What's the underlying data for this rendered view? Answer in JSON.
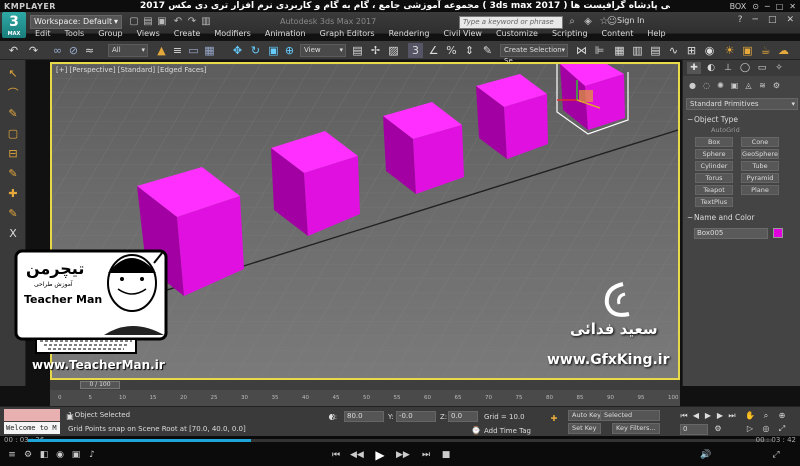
{
  "player": {
    "logo": "KMPLAYER",
    "title": "مجموعه آموزشی جامع ، گام به گام و کاربردی نرم افزار تری دی مکس 2017 ( 3ds max 2017 )  مدرس : سعید فدایی ( تیچرمن ) گروه آموزشی پادشاه گرافیست ها",
    "controls_label": "BOX",
    "time_current": "00 : 03 : 26",
    "time_total": "00 : 03 : 42",
    "progress": 0.3
  },
  "max": {
    "logo_number": "3",
    "logo_text": "MAX",
    "workspace": "Workspace: Default",
    "app_title": "Autodesk 3ds Max 2017",
    "search_placeholder": "Type a keyword or phrase",
    "signin": "Sign In",
    "menus": [
      "Edit",
      "Tools",
      "Group",
      "Views",
      "Create",
      "Modifiers",
      "Animation",
      "Graph Editors",
      "Rendering",
      "Civil View",
      "Customize",
      "Scripting",
      "Content",
      "Help"
    ]
  },
  "toolbar": {
    "filter_drop": "All",
    "coord_drop": "View",
    "selection_set": "Create Selection Se"
  },
  "viewport": {
    "label": "[+] [Perspective] [Standard] [Edged Faces]",
    "box_color": "#e010e0"
  },
  "command_panel": {
    "primitive_type": "Standard Primitives",
    "object_type_title": "Object Type",
    "autogrid": "AutoGrid",
    "primitives": [
      "Box",
      "Cone",
      "Sphere",
      "GeoSphere",
      "Cylinder",
      "Tube",
      "Torus",
      "Pyramid",
      "Teapot",
      "Plane",
      "TextPlus"
    ],
    "name_color_title": "Name and Color",
    "object_name": "Box005",
    "object_color": "#e000e0"
  },
  "timeline": {
    "thumb": "0 / 100",
    "ticks": [
      "0",
      "5",
      "10",
      "15",
      "20",
      "25",
      "30",
      "35",
      "40",
      "45",
      "50",
      "55",
      "60",
      "65",
      "70",
      "75",
      "80",
      "85",
      "90",
      "95",
      "100"
    ]
  },
  "status": {
    "listener_text": "Welcome to M",
    "selected": "1 Object Selected",
    "prompt": "Grid Points snap on Scene Root at [70.0, 40.0, 0.0]",
    "x_label": "X:",
    "x_value": "80.0",
    "y_label": "Y:",
    "y_value": "-0.0",
    "z_label": "Z:",
    "z_value": "0.0",
    "grid": "Grid = 10.0",
    "add_time_tag": "Add Time Tag",
    "auto_key": "Auto Key",
    "set_key": "Set Key",
    "key_mode": "Selected",
    "key_filters": "Key Filters...",
    "frame": "0"
  },
  "watermark": {
    "teacher_logo": "تیچرمن",
    "teacher_sub": "آموزش طراحی",
    "teacher_name": "Teacher Man",
    "teacher_url": "www.TeacherMan.ir",
    "saeed_name": "سعید فدائی",
    "gfx_url": "www.GfxKing.ir"
  }
}
